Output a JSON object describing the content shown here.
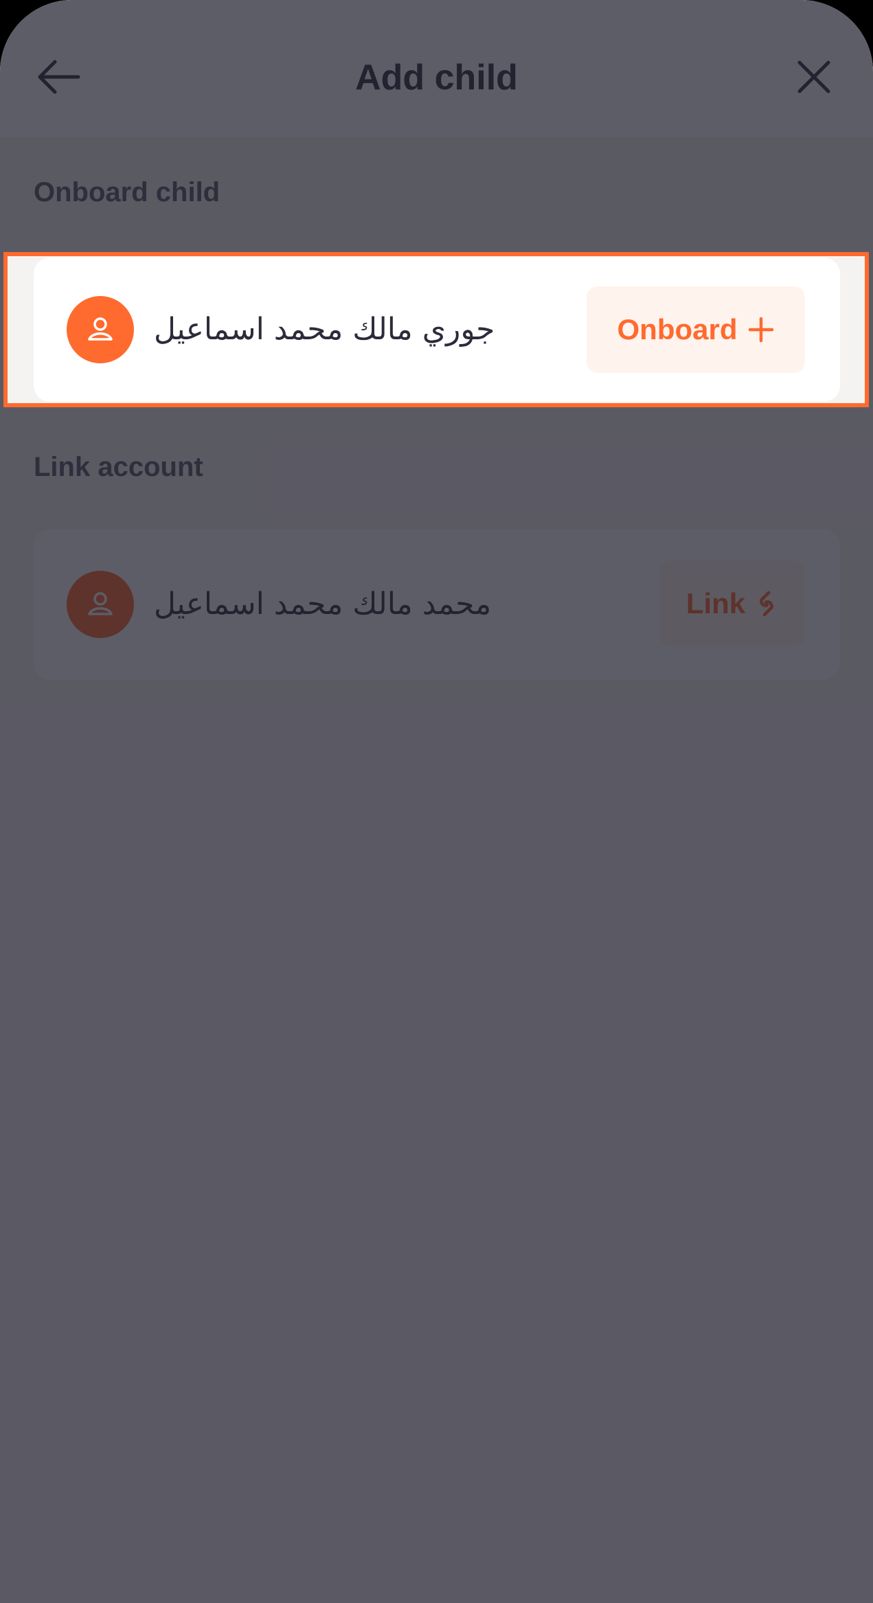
{
  "header": {
    "title": "Add child",
    "back_icon": "arrow-left-icon",
    "close_icon": "close-icon"
  },
  "onboard_section": {
    "label": "Onboard child",
    "child": {
      "name": "جوري مالك محمد اسماعيل",
      "avatar_icon": "user-icon",
      "action_label": "Onboard",
      "action_icon": "plus-icon"
    }
  },
  "link_section": {
    "label": "Link account",
    "child": {
      "name": "محمد مالك محمد اسماعيل",
      "avatar_icon": "user-icon",
      "action_label": "Link",
      "action_icon": "link-icon"
    }
  },
  "colors": {
    "accent": "#FF6A2E",
    "accent_light": "#FFF3EE",
    "text_dark": "#2B2B3A",
    "overlay": "rgba(30,30,45,0.72)"
  }
}
